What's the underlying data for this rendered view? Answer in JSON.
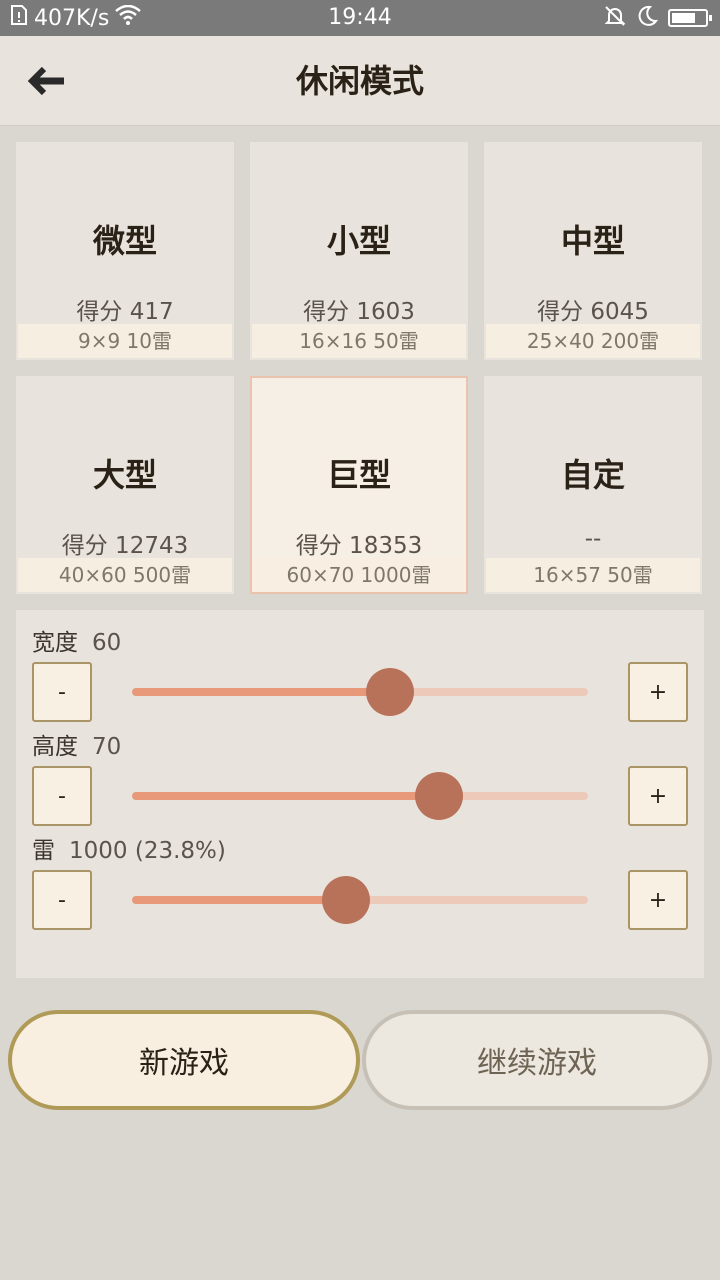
{
  "status_bar": {
    "net_speed": "407K/s",
    "time": "19:44",
    "battery_level": 0.75
  },
  "header": {
    "title": "休闲模式"
  },
  "presets": [
    {
      "name": "微型",
      "score": "得分 417",
      "spec": "9×9  10雷",
      "selected": false
    },
    {
      "name": "小型",
      "score": "得分 1603",
      "spec": "16×16  50雷",
      "selected": false
    },
    {
      "name": "中型",
      "score": "得分 6045",
      "spec": "25×40  200雷",
      "selected": false
    },
    {
      "name": "大型",
      "score": "得分 12743",
      "spec": "40×60  500雷",
      "selected": false
    },
    {
      "name": "巨型",
      "score": "得分 18353",
      "spec": "60×70  1000雷",
      "selected": true
    },
    {
      "name": "自定",
      "score": "--",
      "spec": "16×57  50雷",
      "selected": false
    }
  ],
  "custom": {
    "width": {
      "label": "宽度",
      "value": "60",
      "fraction": 0.566
    },
    "height": {
      "label": "高度",
      "value": "70",
      "fraction": 0.673
    },
    "mines": {
      "label": "雷",
      "value": "1000 (23.8%)",
      "fraction": 0.47
    },
    "minus_label": "-",
    "plus_label": "+"
  },
  "actions": {
    "new_game": "新游戏",
    "continue_game": "继续游戏"
  },
  "colors": {
    "accent": "#e8997a",
    "thumb": "#b87259",
    "button_border": "#a99565"
  }
}
